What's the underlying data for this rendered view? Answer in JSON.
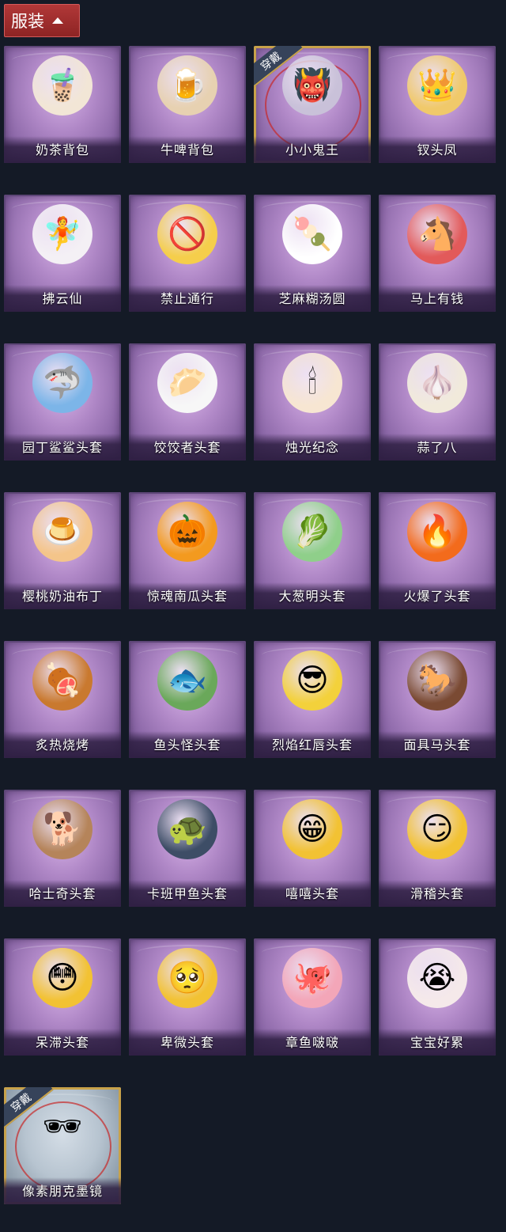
{
  "header": {
    "title": "服装"
  },
  "equipped_tag": "穿戴",
  "items": [
    {
      "name": "奶茶背包",
      "icon": "bubble-tea-backpack-icon",
      "glyph": "🧋",
      "color": "#f2e6d6",
      "equipped": false
    },
    {
      "name": "牛啤背包",
      "icon": "cow-beer-backpack-icon",
      "glyph": "🍺",
      "color": "#e7d1b1",
      "equipped": false
    },
    {
      "name": "小小鬼王",
      "icon": "ghost-king-icon",
      "glyph": "👹",
      "color": "#c9c1d9",
      "equipped": true
    },
    {
      "name": "钗头凤",
      "icon": "phoenix-crown-icon",
      "glyph": "👑",
      "color": "#f0c96a",
      "equipped": false
    },
    {
      "name": "拂云仙",
      "icon": "cloud-fairy-icon",
      "glyph": "🧚",
      "color": "#f4f0f5",
      "equipped": false
    },
    {
      "name": "禁止通行",
      "icon": "no-entry-icon",
      "glyph": "🚫",
      "color": "#f5ce4b",
      "equipped": false
    },
    {
      "name": "芝麻糊汤圆",
      "icon": "rice-ball-icon",
      "glyph": "🍡",
      "color": "#ffffff",
      "equipped": false
    },
    {
      "name": "马上有钱",
      "icon": "horse-icon",
      "glyph": "🐴",
      "color": "#e25a5a",
      "equipped": false
    },
    {
      "name": "园丁鲨鲨头套",
      "icon": "shark-head-icon",
      "glyph": "🦈",
      "color": "#7cb5e8",
      "equipped": false
    },
    {
      "name": "饺饺者头套",
      "icon": "dumpling-head-icon",
      "glyph": "🥟",
      "color": "#f7f7f7",
      "equipped": false
    },
    {
      "name": "烛光纪念",
      "icon": "candle-icon",
      "glyph": "🕯",
      "color": "#f7e6d2",
      "equipped": false
    },
    {
      "name": "蒜了八",
      "icon": "garlic-icon",
      "glyph": "🧄",
      "color": "#f1eadb",
      "equipped": false
    },
    {
      "name": "樱桃奶油布丁",
      "icon": "pudding-icon",
      "glyph": "🍮",
      "color": "#f4c58a",
      "equipped": false
    },
    {
      "name": "惊魂南瓜头套",
      "icon": "pumpkin-head-icon",
      "glyph": "🎃",
      "color": "#f39a1f",
      "equipped": false
    },
    {
      "name": "大葱明头套",
      "icon": "scallion-head-icon",
      "glyph": "🥬",
      "color": "#8fcf8a",
      "equipped": false
    },
    {
      "name": "火爆了头套",
      "icon": "fire-head-icon",
      "glyph": "🔥",
      "color": "#f36b1c",
      "equipped": false
    },
    {
      "name": "炙热烧烤",
      "icon": "barbecue-icon",
      "glyph": "🍖",
      "color": "#c9792f",
      "equipped": false
    },
    {
      "name": "鱼头怪头套",
      "icon": "fish-head-icon",
      "glyph": "🐟",
      "color": "#6aa85a",
      "equipped": false
    },
    {
      "name": "烈焰红唇头套",
      "icon": "pikachu-head-icon",
      "glyph": "😎",
      "color": "#f3d13b",
      "equipped": false
    },
    {
      "name": "面具马头套",
      "icon": "horse-mask-icon",
      "glyph": "🐎",
      "color": "#7a4a33",
      "equipped": false
    },
    {
      "name": "哈士奇头套",
      "icon": "husky-head-icon",
      "glyph": "🐕",
      "color": "#b5845a",
      "equipped": false
    },
    {
      "name": "卡班甲鱼头套",
      "icon": "turtle-head-icon",
      "glyph": "🐢",
      "color": "#3d4d66",
      "equipped": false
    },
    {
      "name": "嘻嘻头套",
      "icon": "grin-head-icon",
      "glyph": "😁",
      "color": "#f2c233",
      "equipped": false
    },
    {
      "name": "滑稽头套",
      "icon": "funny-face-head-icon",
      "glyph": "😏",
      "color": "#f2c233",
      "equipped": false
    },
    {
      "name": "呆滞头套",
      "icon": "dazed-head-icon",
      "glyph": "😳",
      "color": "#f2c233",
      "equipped": false
    },
    {
      "name": "卑微头套",
      "icon": "humble-head-icon",
      "glyph": "🥺",
      "color": "#f2c233",
      "equipped": false
    },
    {
      "name": "章鱼啵啵",
      "icon": "octopus-icon",
      "glyph": "🐙",
      "color": "#f3a6b8",
      "equipped": false
    },
    {
      "name": "宝宝好累",
      "icon": "tired-baby-icon",
      "glyph": "😭",
      "color": "#f5e9ea",
      "equipped": false
    },
    {
      "name": "像素朋克墨镜",
      "icon": "pixel-sunglasses-icon",
      "glyph": "🕶",
      "color": "#000000",
      "equipped": true,
      "style": "blue"
    }
  ]
}
